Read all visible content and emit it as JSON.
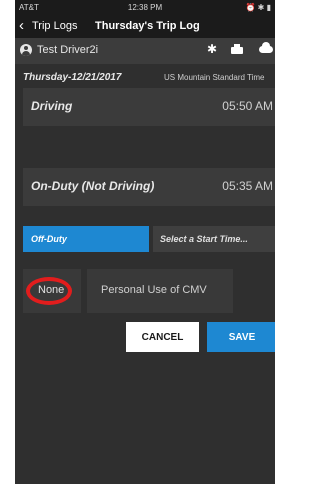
{
  "status_bar": {
    "carrier": "AT&T",
    "time": "12:38 PM",
    "indicators": "⏰ ✱ ▮"
  },
  "nav": {
    "back_label": "Trip Logs",
    "title": "Thursday's Trip Log"
  },
  "driver": {
    "name": "Test Driver2i",
    "icons": [
      "bluetooth-icon",
      "truck-icon",
      "cloud-icon"
    ]
  },
  "log": {
    "date": "Thursday-12/21/2017",
    "timezone": "US Mountain Standard Time",
    "entries": [
      {
        "status": "Driving",
        "time": "05:50 AM"
      },
      {
        "status": "On-Duty (Not Driving)",
        "time": "05:35 AM"
      }
    ]
  },
  "duty_change": {
    "selected_status": "Off-Duty",
    "start_time_placeholder": "Select a Start Time..."
  },
  "special_options": {
    "none_label": "None",
    "personal_use_label": "Personal Use of CMV"
  },
  "actions": {
    "cancel": "CANCEL",
    "save": "SAVE"
  },
  "colors": {
    "accent": "#1e88d2",
    "highlight": "#e21d1d",
    "background": "#2f2f2f"
  }
}
